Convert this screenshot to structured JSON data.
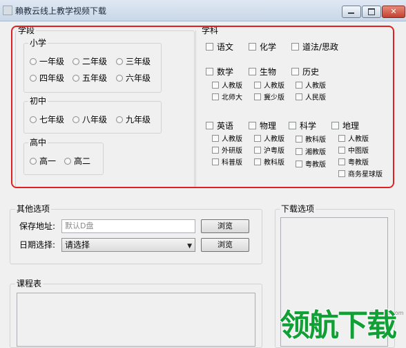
{
  "window": {
    "title": "賴教云线上教学视频下载"
  },
  "stage": {
    "label": "学段",
    "primary": {
      "label": "小学",
      "grades": [
        "一年级",
        "二年级",
        "三年级",
        "四年级",
        "五年级",
        "六年级"
      ]
    },
    "junior": {
      "label": "初中",
      "grades": [
        "七年级",
        "八年级",
        "九年级"
      ]
    },
    "senior": {
      "label": "高中",
      "grades": [
        "高一",
        "高二"
      ]
    }
  },
  "subject": {
    "label": "学科",
    "row1": [
      "语文",
      "化学",
      "道法/思政"
    ],
    "row2": [
      "数学",
      "生物",
      "历史"
    ],
    "math_editions": [
      "人教版",
      "北师大"
    ],
    "bio_editions": [
      "人教版",
      "冀少版"
    ],
    "history_editions": [
      "人教版",
      "人民版"
    ],
    "row3": [
      "英语",
      "物理",
      "科学",
      "地理"
    ],
    "english_editions": [
      "人教版",
      "外研版",
      "科普版"
    ],
    "physics_editions": [
      "人教版",
      "沪粤版",
      "教科版"
    ],
    "science_editions": [
      "教科版",
      "湘教版",
      "粤教版"
    ],
    "geography_editions": [
      "人教版",
      "中图版",
      "粤教版",
      "商务星球版"
    ]
  },
  "other": {
    "label": "其他选项",
    "save_label": "保存地址:",
    "save_placeholder": "默认D盘",
    "browse1": "浏览",
    "date_label": "日期选择:",
    "date_value": "请选择",
    "browse2": "浏览"
  },
  "schedule": {
    "label": "课程表"
  },
  "download": {
    "label": "下载选项"
  },
  "watermark": {
    "site": "lhdown.com",
    "brand": "领航下载"
  }
}
